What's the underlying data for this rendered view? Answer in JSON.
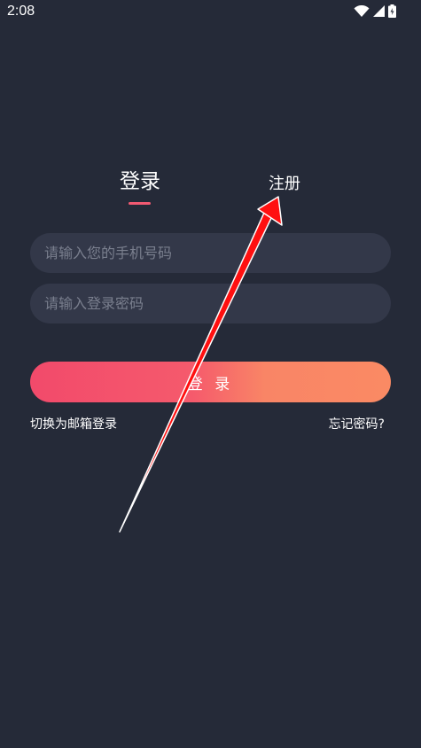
{
  "status_bar": {
    "time": "2:08"
  },
  "tabs": {
    "login_label": "登录",
    "register_label": "注册"
  },
  "form": {
    "phone_placeholder": "请输入您的手机号码",
    "password_placeholder": "请输入登录密码",
    "login_button": "登 录"
  },
  "links": {
    "switch_email": "切换为邮箱登录",
    "forgot_password": "忘记密码?"
  },
  "colors": {
    "background": "#252a38",
    "field_bg": "#333849",
    "accent": "#f25a72",
    "annotation_arrow": "#ff0000"
  },
  "icons": [
    "wifi-icon",
    "signal-icon",
    "battery-icon"
  ]
}
